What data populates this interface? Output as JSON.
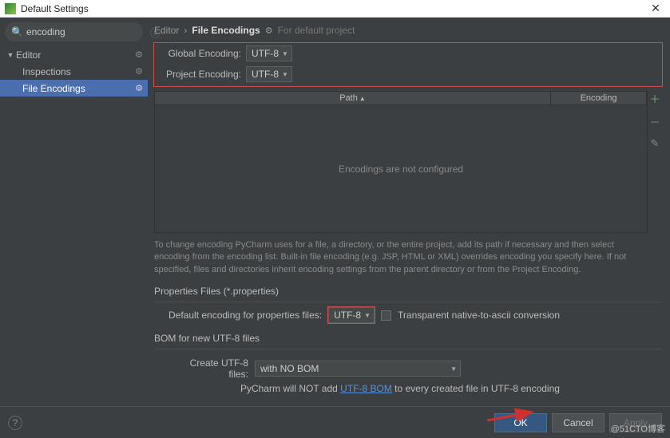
{
  "window": {
    "title": "Default Settings"
  },
  "search": {
    "value": "encoding"
  },
  "sidebar": {
    "items": [
      {
        "label": "Editor"
      },
      {
        "label": "Inspections"
      },
      {
        "label": "File Encodings"
      }
    ]
  },
  "breadcrumb": {
    "root": "Editor",
    "leaf": "File Encodings",
    "note": "For default project"
  },
  "encodings": {
    "global_label": "Global Encoding:",
    "global_value": "UTF-8",
    "project_label": "Project Encoding:",
    "project_value": "UTF-8"
  },
  "table": {
    "col_path": "Path",
    "col_encoding": "Encoding",
    "empty_text": "Encodings are not configured"
  },
  "hint": "To change encoding PyCharm uses for a file, a directory, or the entire project, add its path if necessary and then select encoding from the encoding list. Built-in file encoding (e.g. JSP, HTML or XML) overrides encoding you specify here. If not specified, files and directories inherit encoding settings from the parent directory or from the Project Encoding.",
  "properties": {
    "section": "Properties Files (*.properties)",
    "default_label": "Default encoding for properties files:",
    "default_value": "UTF-8",
    "checkbox_label": "Transparent native-to-ascii conversion"
  },
  "bom": {
    "section": "BOM for new UTF-8 files",
    "create_label": "Create UTF-8 files:",
    "create_value": "with NO BOM",
    "note_pre": "PyCharm will NOT add ",
    "note_link": "UTF-8 BOM",
    "note_post": " to every created file in UTF-8 encoding"
  },
  "buttons": {
    "ok": "OK",
    "cancel": "Cancel",
    "apply": "Apply"
  },
  "watermark": "@51CTO博客"
}
